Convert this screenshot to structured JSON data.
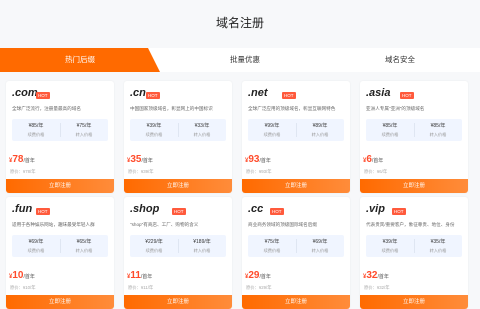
{
  "page_title": "域名注册",
  "tabs": [
    "热门后缀",
    "批量优惠",
    "域名安全"
  ],
  "cards": [
    {
      "domain": ".com",
      "hot": "HOT",
      "desc": "全球广泛流行，注册量最高的域名",
      "p1": "¥85/年",
      "p1l": "续费价格",
      "p2": "¥75/年",
      "p2l": "转入价格",
      "cur": "¥",
      "price": "78",
      "unit": "/首年",
      "orig": "原价：¥78/年",
      "buy": "立即注册"
    },
    {
      "domain": ".cn",
      "hot": "HOT",
      "desc": "中国国家顶级域名，彰显网上的中国标识",
      "p1": "¥39/年",
      "p1l": "续费价格",
      "p2": "¥33/年",
      "p2l": "转入价格",
      "cur": "¥",
      "price": "35",
      "unit": "/首年",
      "orig": "原价：¥39/年",
      "buy": "立即注册"
    },
    {
      "domain": ".net",
      "hot": "HOT",
      "desc": "全球广泛应用的顶级域名，彰显互联网特色",
      "p1": "¥99/年",
      "p1l": "续费价格",
      "p2": "¥89/年",
      "p2l": "转入价格",
      "cur": "¥",
      "price": "93",
      "unit": "/首年",
      "orig": "原价：¥93/年",
      "buy": "立即注册"
    },
    {
      "domain": ".asia",
      "hot": "HOT",
      "desc": "亚洲人专属\"亚洲\"的顶级域名",
      "p1": "¥85/年",
      "p1l": "续费价格",
      "p2": "¥85/年",
      "p2l": "转入价格",
      "cur": "¥",
      "price": "6",
      "unit": "/首年",
      "orig": "原价：¥6/年",
      "buy": "立即注册"
    },
    {
      "domain": ".fun",
      "hot": "HOT",
      "desc": "适用于各种娱乐网站，趣味最受年轻人群",
      "p1": "¥69/年",
      "p1l": "续费价格",
      "p2": "¥65/年",
      "p2l": "转入价格",
      "cur": "¥",
      "price": "10",
      "unit": "/首年",
      "orig": "原价：¥10/年",
      "buy": "立即注册"
    },
    {
      "domain": ".shop",
      "hot": "HOT",
      "desc": "\"shop\"有商店、工厂、购物的含义",
      "p1": "¥229/年",
      "p1l": "续费价格",
      "p2": "¥189/年",
      "p2l": "转入价格",
      "cur": "¥",
      "price": "11",
      "unit": "/首年",
      "orig": "原价：¥11/年",
      "buy": "立即注册"
    },
    {
      "domain": ".cc",
      "hot": "HOT",
      "desc": "商业商务领域的顶级国际域名后缀",
      "p1": "¥75/年",
      "p1l": "续费价格",
      "p2": "¥69/年",
      "p2l": "转入价格",
      "cur": "¥",
      "price": "29",
      "unit": "/首年",
      "orig": "原价：¥29/年",
      "buy": "立即注册"
    },
    {
      "domain": ".vip",
      "hot": "HOT",
      "desc": "代表贵宾/重要客户，象征尊贵、地位、身份",
      "p1": "¥39/年",
      "p1l": "续费价格",
      "p2": "¥35/年",
      "p2l": "转入价格",
      "cur": "¥",
      "price": "32",
      "unit": "/首年",
      "orig": "原价：¥32/年",
      "buy": "立即注册"
    }
  ]
}
